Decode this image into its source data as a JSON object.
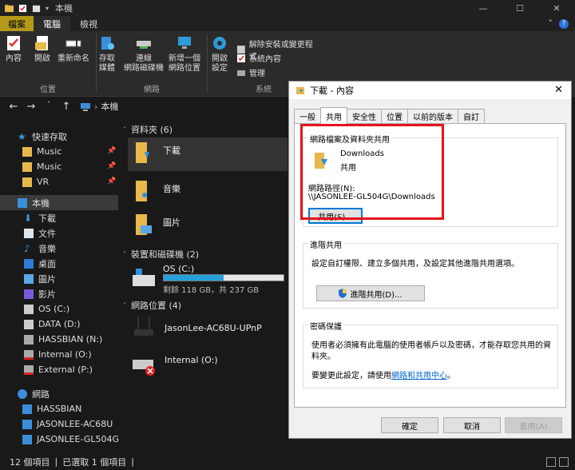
{
  "window": {
    "title": "本機"
  },
  "ribbon_tabs": {
    "file": "檔案",
    "computer": "電腦",
    "view": "檢視"
  },
  "ribbon": {
    "location_group": "位置",
    "network_group": "網路",
    "system_group": "系統",
    "properties": "內容",
    "open": "開啟",
    "rename": "重新命名",
    "access_media_1": "存取",
    "access_media_2": "媒體",
    "map_drive_1": "連線",
    "map_drive_2": "網路磁碟機",
    "add_location_1": "新增一個",
    "add_location_2": "網路位置",
    "open_settings_1": "開啟",
    "open_settings_2": "設定",
    "uninstall": "解除安裝或變更程式",
    "system_props": "系統內容",
    "manage": "管理"
  },
  "address": {
    "path": "本機"
  },
  "sidebar": {
    "quick_access": "快速存取",
    "music_pinned": "Music",
    "music2_pinned": "Music",
    "vr_pinned": "VR",
    "this_pc": "本機",
    "downloads": "下載",
    "documents": "文件",
    "music": "音樂",
    "desktop": "桌面",
    "pictures": "圖片",
    "videos": "影片",
    "os_c": "OS (C:)",
    "data_d": "DATA (D:)",
    "hassbian_n": "HASSBIAN (N:)",
    "internal_o": "Internal (O:)",
    "external_p": "External (P:)",
    "network": "網路",
    "net_hassbian": "HASSBIAN",
    "net_jasonlee_ac68u": "JASONLEE-AC68U",
    "net_jasonlee_gl504g": "JASONLEE-GL504G"
  },
  "content": {
    "folders_header": "資料夾 (6)",
    "folder_downloads": "下載",
    "folder_music": "音樂",
    "folder_pictures": "圖片",
    "devices_header": "裝置和磁碟機 (2)",
    "drive_c_name": "OS (C:)",
    "drive_c_free": "剩餘 118 GB，共 237 GB",
    "drive_c_used_fraction": 0.5,
    "netloc_header": "網路位置 (4)",
    "netloc_router": "JasonLee-AC68U-UPnP",
    "netloc_internal": "Internal (O:)"
  },
  "statusbar": {
    "count": "12 個項目",
    "selected": "已選取 1 個項目"
  },
  "dialog": {
    "title": "下載 - 內容",
    "close": "✕",
    "tabs": [
      "一般",
      "共用",
      "安全性",
      "位置",
      "以前的版本",
      "自訂"
    ],
    "share_section": "網路檔案及資料夾共用",
    "folder_name": "Downloads",
    "share_status": "共用",
    "net_path_label": "網路路徑(N):",
    "net_path": "\\\\JASONLEE-GL504G\\Downloads",
    "share_button": "共用(S)...",
    "advanced_section": "進階共用",
    "advanced_desc": "設定自訂權限、建立多個共用，及設定其他進階共用選項。",
    "advanced_button": "進階共用(D)...",
    "password_section": "密碼保護",
    "password_desc_1": "使用者必須擁有此電腦的使用者帳戶以及密碼，才能存取您共用的資",
    "password_desc_2": "料夾。",
    "change_prefix": "要變更此設定，請使用",
    "change_link": "網路和共用中心",
    "change_suffix": "。",
    "ok": "確定",
    "cancel": "取消",
    "apply": "套用(A)"
  },
  "colors": {
    "accent": "#b59a1a",
    "highlight": "#e5141b",
    "link": "#0066cc",
    "progress": "#26a0da"
  }
}
